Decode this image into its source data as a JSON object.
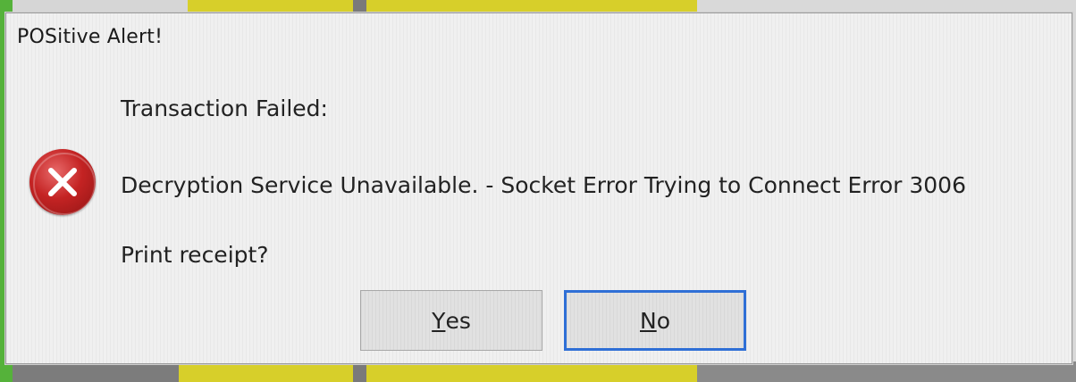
{
  "dialog": {
    "title": "POSitive Alert!",
    "icon": "error-icon",
    "message_heading": "Transaction Failed:",
    "message_detail": "Decryption Service Unavailable. - Socket Error Trying to Connect Error 3006",
    "question": "Print receipt?"
  },
  "buttons": {
    "yes": {
      "mnemonic": "Y",
      "rest": "es",
      "focused": false
    },
    "no": {
      "mnemonic": "N",
      "rest": "o",
      "focused": true
    }
  },
  "colors": {
    "focus_border": "#2f6fd6",
    "error_icon": "#c42323",
    "dialog_bg": "#f0f0f0"
  }
}
